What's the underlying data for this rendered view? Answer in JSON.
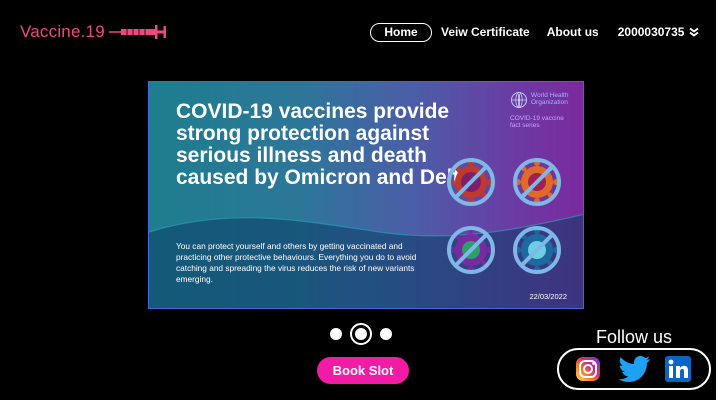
{
  "brand": {
    "name": "Vaccine.19",
    "color": "#f0487e",
    "icon": "syringe-icon"
  },
  "nav": {
    "home": "Home",
    "certificate": "Veiw Certificate",
    "about": "About us",
    "user_id": "2000030735",
    "user_menu_icon": "double-chevron-down-icon"
  },
  "banner": {
    "headline": "COVID-19 vaccines provide strong protection against serious illness and death caused by Omicron and Delta",
    "body": "You can protect yourself and others by getting vaccinated and practicing other protective behaviours. Everything you do to avoid catching and spreading the virus reduces the risk of new variants emerging.",
    "date": "22/03/2022",
    "org": [
      "World Health",
      "Organization"
    ],
    "series": [
      "COVID-19 vaccine",
      "fact series"
    ],
    "icons": [
      "crossed-virus-icon",
      "crossed-virus-icon",
      "crossed-virus-icon",
      "crossed-virus-icon"
    ]
  },
  "carousel": {
    "slides": 3,
    "active": 2
  },
  "book_slot": {
    "label": "Book Slot",
    "color": "#f21ba6"
  },
  "follow": {
    "title": "Follow us",
    "links": [
      "instagram-icon",
      "twitter-icon",
      "linkedin-icon"
    ]
  }
}
